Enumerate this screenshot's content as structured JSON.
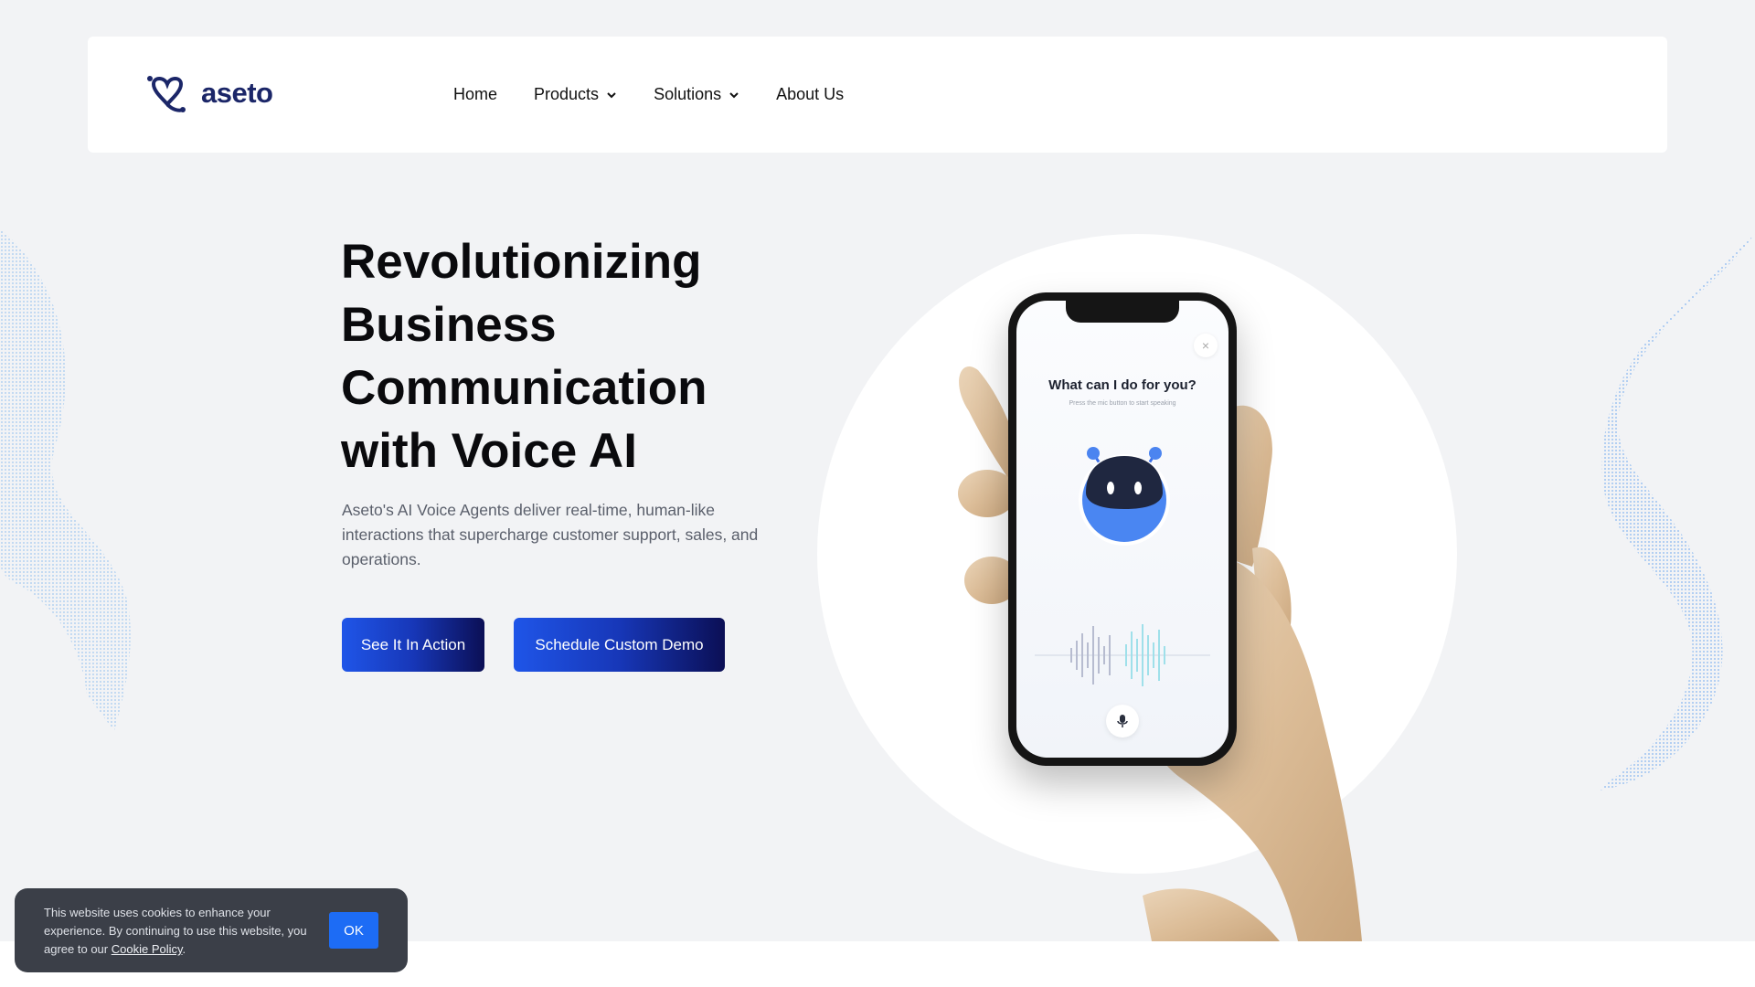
{
  "brand": {
    "name": "aseto",
    "color": "#1b2668"
  },
  "nav": {
    "items": [
      {
        "label": "Home",
        "has_dropdown": false
      },
      {
        "label": "Products",
        "has_dropdown": true
      },
      {
        "label": "Solutions",
        "has_dropdown": true
      },
      {
        "label": "About Us",
        "has_dropdown": false
      }
    ]
  },
  "hero": {
    "title_lines": [
      "Revolutionizing",
      "Business",
      "Communication",
      "with Voice AI"
    ],
    "subtitle": "Aseto's AI Voice Agents deliver real-time, human-like interactions that supercharge customer support, sales, and operations.",
    "primary_button": "See It In Action",
    "secondary_button": "Schedule Custom Demo"
  },
  "phone": {
    "close_icon": "×",
    "prompt": "What can I do for you?",
    "hint": "Press the mic button to start speaking"
  },
  "cookie": {
    "text": "This website uses cookies to enhance your experience. By continuing to use this website, you agree to our",
    "link": "Cookie Policy",
    "after_link": ".",
    "ok": "OK"
  },
  "colors": {
    "accent": "#1f55e8",
    "button_dark": "#0b0f55",
    "background": "#f2f3f5"
  }
}
